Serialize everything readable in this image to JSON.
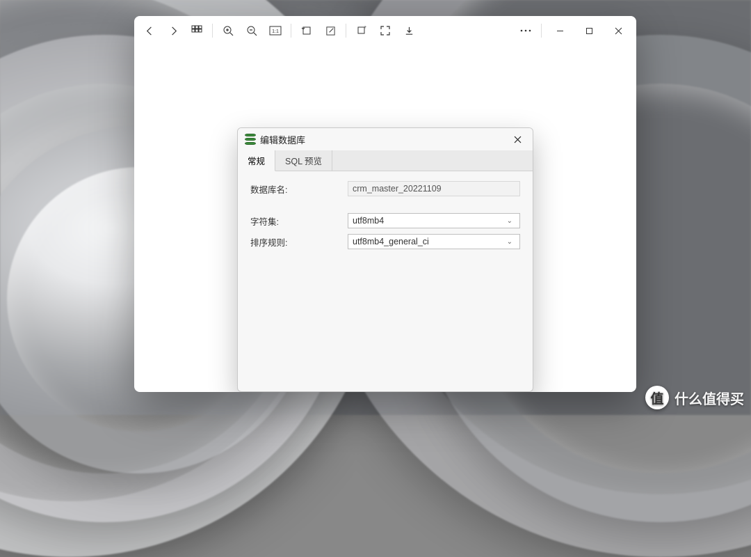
{
  "viewer": {
    "toolbar_icons": {
      "back": "back-icon",
      "forward": "forward-icon",
      "gallery": "gallery-icon",
      "zoom_in": "zoom-in-icon",
      "zoom_out": "zoom-out-icon",
      "fit": "fit-icon",
      "rotate": "rotate-icon",
      "edit": "edit-icon",
      "crop": "crop-icon",
      "fullscreen": "fullscreen-icon",
      "save": "save-icon",
      "more": "more-icon",
      "minimize": "minimize-icon",
      "maximize": "maximize-icon",
      "close": "close-icon"
    }
  },
  "dialog": {
    "title": "编辑数据库",
    "tabs": {
      "general": "常规",
      "sql_preview": "SQL 预览"
    },
    "fields": {
      "db_name_label": "数据库名:",
      "db_name_value": "crm_master_20221109",
      "charset_label": "字符集:",
      "charset_value": "utf8mb4",
      "collation_label": "排序规则:",
      "collation_value": "utf8mb4_general_ci"
    }
  },
  "watermark": {
    "badge": "值",
    "text": "什么值得买"
  }
}
